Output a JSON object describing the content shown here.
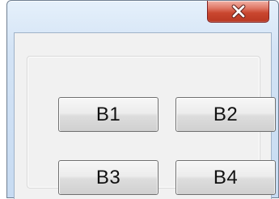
{
  "window": {
    "close_button_icon": "close-icon"
  },
  "buttons": {
    "b1": "B1",
    "b2": "B2",
    "b3": "B3",
    "b4": "B4"
  },
  "colors": {
    "window_frame": "#c7dbf2",
    "close_button": "#c9462f",
    "client_background": "#f1f1f1",
    "button_text": "#111111"
  }
}
